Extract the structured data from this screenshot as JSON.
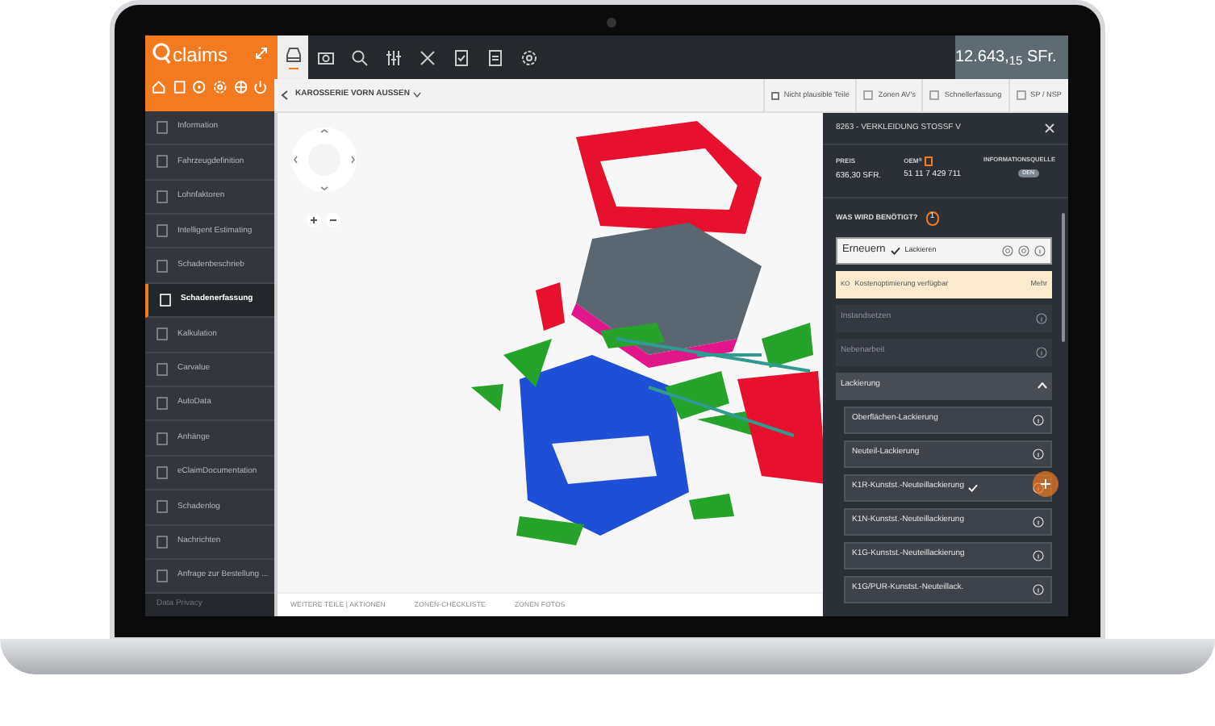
{
  "logo": {
    "text": "claims"
  },
  "sidebar": {
    "items": [
      {
        "label": "Information",
        "selected": false
      },
      {
        "label": "Fahrzeugdefinition",
        "selected": false
      },
      {
        "label": "Lohnfaktoren",
        "selected": false
      },
      {
        "label": "Intelligent Estimating",
        "selected": false
      },
      {
        "label": "Schadenbeschrieb",
        "selected": false
      },
      {
        "label": "Schadenerfassung",
        "selected": true
      },
      {
        "label": "Kalkulation",
        "selected": false
      },
      {
        "label": "Carvalue",
        "selected": false
      },
      {
        "label": "AutoData",
        "selected": false
      },
      {
        "label": "Anhänge",
        "selected": false
      },
      {
        "label": "eClaimDocumentation",
        "selected": false
      },
      {
        "label": "Schadenlog",
        "selected": false
      },
      {
        "label": "Nachrichten",
        "selected": false
      },
      {
        "label": "Anfrage zur Bestellung ...",
        "selected": false
      }
    ],
    "footer": "Data Privacy"
  },
  "toolbar": {
    "tabs": [
      {
        "selected": true
      },
      {
        "selected": false
      },
      {
        "selected": false
      },
      {
        "selected": false
      },
      {
        "selected": false
      },
      {
        "selected": false
      },
      {
        "selected": false
      },
      {
        "selected": false
      }
    ],
    "total": "12.643,$_{15}$ SFr."
  },
  "subbar": {
    "breadcrumb": "KAROSSERIE VORN AUSSEN",
    "filters": [
      {
        "kind": "checkbox",
        "label": "Nicht plausible Teile",
        "checked": false
      },
      {
        "kind": "link",
        "label": "Zonen AV's"
      },
      {
        "kind": "link",
        "label": "Schnellerfassung"
      },
      {
        "kind": "link",
        "label": "SP / NSP"
      }
    ]
  },
  "bottom_tabs": [
    "WEITERE TEILE | AKTIONEN",
    "ZONEN-CHECKLISTE",
    "ZONEN FOTOS"
  ],
  "panel": {
    "title": "8263 - VERKLEIDUNG STOSSF V",
    "price_label": "PREIS",
    "price": "636,30 SFR.",
    "oem_label": "OEM$^{®}$",
    "oem": "51 11 7 429 711",
    "source_label": "INFORMATIONSQUELLE",
    "source_badge": "DEN",
    "question": "WAS WIRD BENÖTIGT?",
    "question_badge": "1",
    "action": {
      "label": "Erneuern",
      "tag": "Lackieren"
    },
    "notice": {
      "code": "KO",
      "text": "Kostenoptimierung verfügbar",
      "link": "Mehr"
    },
    "options": [
      {
        "label": "Instandsetzen"
      },
      {
        "label": "Nebenarbeit"
      }
    ],
    "section": {
      "label": "Lackierung",
      "expanded": true,
      "items": [
        {
          "label": "Oberflächen-Lackierung",
          "checked": false
        },
        {
          "label": "Neuteil-Lackierung",
          "checked": false
        },
        {
          "label": "K1R-Kunstst.-Neuteillackierung",
          "checked": true
        },
        {
          "label": "K1N-Kunstst.-Neuteillackierung",
          "checked": false
        },
        {
          "label": "K1G-Kunstst.-Neuteillackierung",
          "checked": false
        },
        {
          "label": "K1G/PUR-Kunstst.-Neuteillack.",
          "checked": false
        }
      ]
    }
  }
}
